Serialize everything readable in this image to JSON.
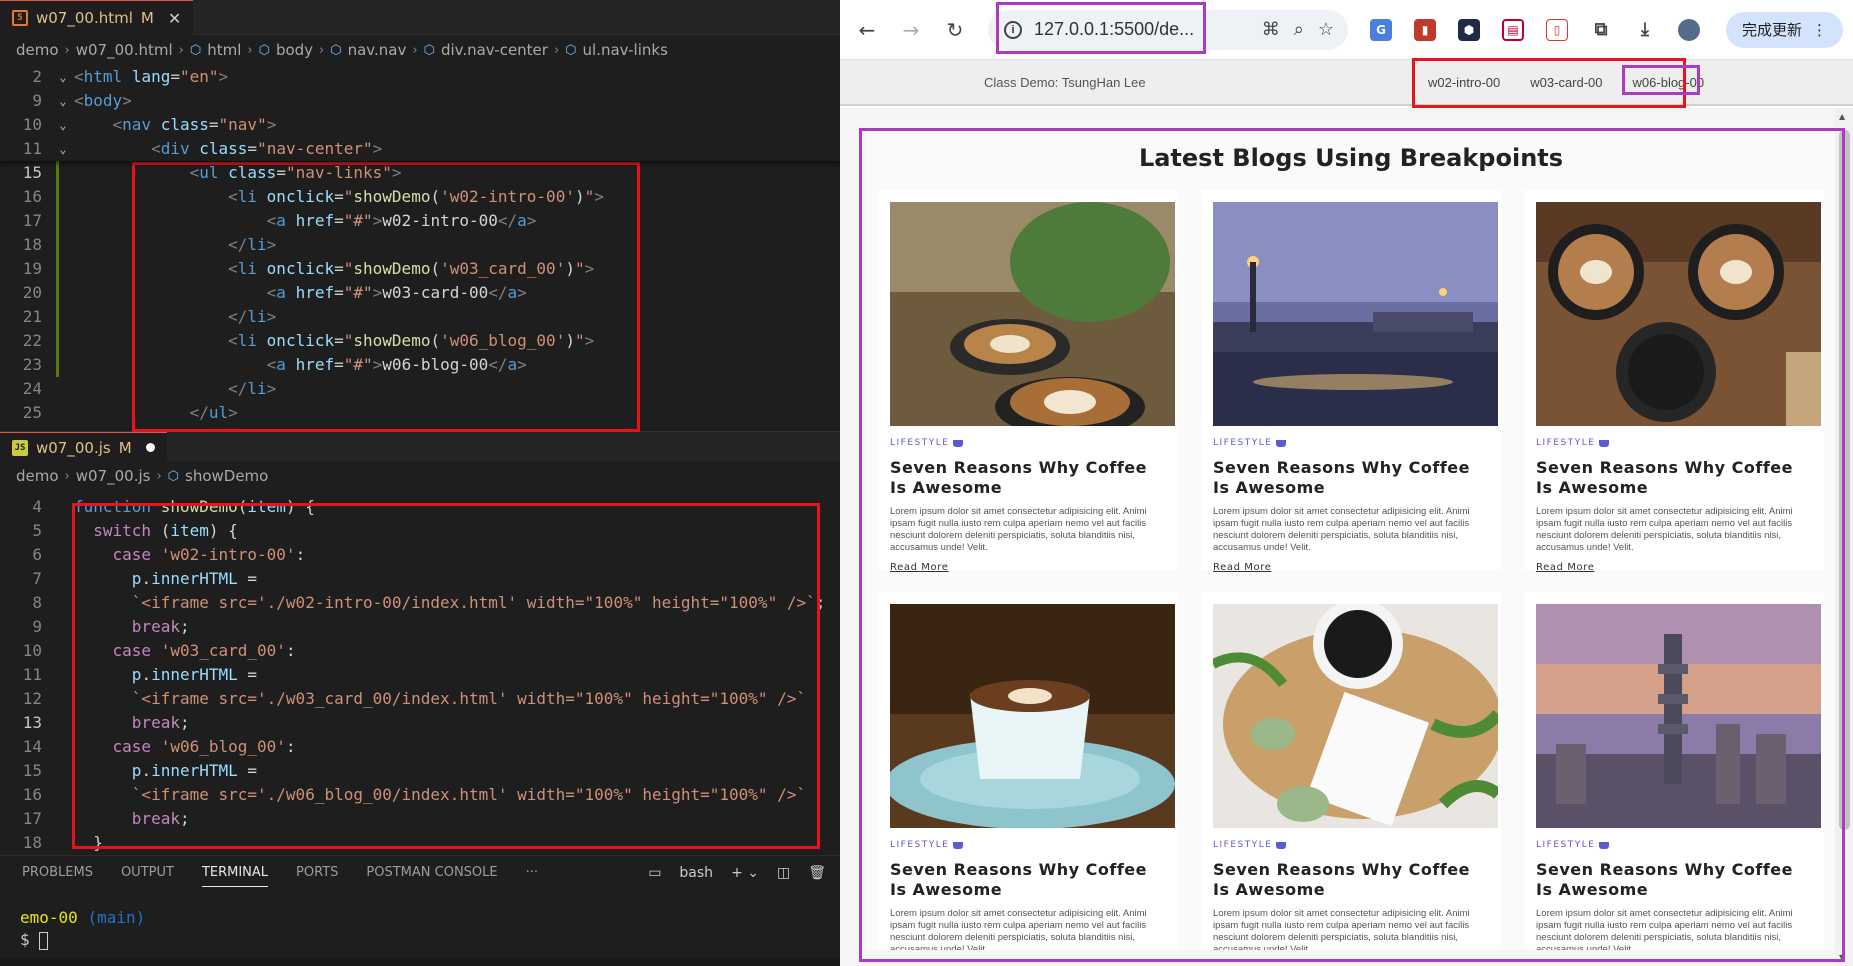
{
  "editor_top": {
    "tab_label": "w07_00.html",
    "tab_status": "M",
    "breadcrumb": [
      "demo",
      "w07_00.html",
      "html",
      "body",
      "nav.nav",
      "div.nav-center",
      "ul.nav-links"
    ],
    "sticky_lines": [
      {
        "n": "2",
        "html": "<span class=\"ang\">&lt;</span><span class=\"tag\">html</span> <span class=\"attr\">lang</span>=<span class=\"str\">\"en\"</span><span class=\"ang\">&gt;</span>"
      },
      {
        "n": "9",
        "html": "<span class=\"ang\">&lt;</span><span class=\"tag\">body</span><span class=\"ang\">&gt;</span>"
      },
      {
        "n": "10",
        "html": "    <span class=\"ang\">&lt;</span><span class=\"tag\">nav</span> <span class=\"attr\">class</span>=<span class=\"str\">\"nav\"</span><span class=\"ang\">&gt;</span>"
      },
      {
        "n": "11",
        "html": "        <span class=\"ang\">&lt;</span><span class=\"tag\">div</span> <span class=\"attr\">class</span>=<span class=\"str\">\"nav-center\"</span><span class=\"ang\">&gt;</span>"
      }
    ],
    "lines": [
      {
        "n": "15",
        "html": "            <span class=\"ang\">&lt;</span><span class=\"tag\">ul</span> <span class=\"attr\">class</span>=<span class=\"str\">\"nav-links\"</span><span class=\"ang\">&gt;</span>"
      },
      {
        "n": "16",
        "html": "                <span class=\"ang\">&lt;</span><span class=\"tag\">li</span> <span class=\"attr\">onclick</span>=<span class=\"str\">\"</span><span class=\"fn\">showDemo</span><span class=\"txt\">(</span><span class=\"str\">'w02-intro-00'</span><span class=\"txt\">)</span><span class=\"str\">\"</span><span class=\"ang\">&gt;</span>"
      },
      {
        "n": "17",
        "html": "                    <span class=\"ang\">&lt;</span><span class=\"tag\">a</span> <span class=\"attr\">href</span>=<span class=\"str\">\"#\"</span><span class=\"ang\">&gt;</span><span class=\"txt\">w02-intro-00</span><span class=\"ang\">&lt;/</span><span class=\"tag\">a</span><span class=\"ang\">&gt;</span>"
      },
      {
        "n": "18",
        "html": "                <span class=\"ang\">&lt;/</span><span class=\"tag\">li</span><span class=\"ang\">&gt;</span>"
      },
      {
        "n": "19",
        "html": "                <span class=\"ang\">&lt;</span><span class=\"tag\">li</span> <span class=\"attr\">onclick</span>=<span class=\"str\">\"</span><span class=\"fn\">showDemo</span><span class=\"txt\">(</span><span class=\"str\">'w03_card_00'</span><span class=\"txt\">)</span><span class=\"str\">\"</span><span class=\"ang\">&gt;</span>"
      },
      {
        "n": "20",
        "html": "                    <span class=\"ang\">&lt;</span><span class=\"tag\">a</span> <span class=\"attr\">href</span>=<span class=\"str\">\"#\"</span><span class=\"ang\">&gt;</span><span class=\"txt\">w03-card-00</span><span class=\"ang\">&lt;/</span><span class=\"tag\">a</span><span class=\"ang\">&gt;</span>"
      },
      {
        "n": "21",
        "html": "                <span class=\"ang\">&lt;/</span><span class=\"tag\">li</span><span class=\"ang\">&gt;</span>"
      },
      {
        "n": "22",
        "html": "                <span class=\"ang\">&lt;</span><span class=\"tag\">li</span> <span class=\"attr\">onclick</span>=<span class=\"str\">\"</span><span class=\"fn\">showDemo</span><span class=\"txt\">(</span><span class=\"str\">'w06_blog_00'</span><span class=\"txt\">)</span><span class=\"str\">\"</span><span class=\"ang\">&gt;</span>"
      },
      {
        "n": "23",
        "html": "                    <span class=\"ang\">&lt;</span><span class=\"tag\">a</span> <span class=\"attr\">href</span>=<span class=\"str\">\"#\"</span><span class=\"ang\">&gt;</span><span class=\"txt\">w06-blog-00</span><span class=\"ang\">&lt;/</span><span class=\"tag\">a</span><span class=\"ang\">&gt;</span>"
      },
      {
        "n": "24",
        "html": "                <span class=\"ang\">&lt;/</span><span class=\"tag\">li</span><span class=\"ang\">&gt;</span>"
      },
      {
        "n": "25",
        "html": "            <span class=\"ang\">&lt;/</span><span class=\"tag\">ul</span><span class=\"ang\">&gt;</span>"
      }
    ]
  },
  "editor_bottom": {
    "tab_label": "w07_00.js",
    "tab_status": "M",
    "breadcrumb": [
      "demo",
      "w07_00.js",
      "showDemo"
    ],
    "lines": [
      {
        "n": "4",
        "html": "<span class=\"kw2\">function</span> <span class=\"fn\">showDemo</span><span class=\"txt\">(</span><span class=\"var\">item</span><span class=\"txt\">) {</span>"
      },
      {
        "n": "5",
        "html": "  <span class=\"kw\">switch</span> <span class=\"txt\">(</span><span class=\"var\">item</span><span class=\"txt\">) {</span>"
      },
      {
        "n": "6",
        "html": "    <span class=\"kw\">case</span> <span class=\"str\">'w02-intro-00'</span><span class=\"txt\">:</span>"
      },
      {
        "n": "7",
        "html": "      <span class=\"var\">p</span><span class=\"txt\">.</span><span class=\"var\">innerHTML</span> <span class=\"txt\">=</span>"
      },
      {
        "n": "8",
        "html": "      <span class=\"str\">`&lt;iframe src='./w02-intro-00/index.html' width=\"100%\" height=\"100%\" /&gt;`</span><span class=\"txt\">;</span>"
      },
      {
        "n": "9",
        "html": "      <span class=\"kw\">break</span><span class=\"txt\">;</span>"
      },
      {
        "n": "10",
        "html": "    <span class=\"kw\">case</span> <span class=\"str\">'w03_card_00'</span><span class=\"txt\">:</span>"
      },
      {
        "n": "11",
        "html": "      <span class=\"var\">p</span><span class=\"txt\">.</span><span class=\"var\">innerHTML</span> <span class=\"txt\">=</span>"
      },
      {
        "n": "12",
        "html": "      <span class=\"str\">`&lt;iframe src='./w03_card_00/index.html' width=\"100%\" height=\"100%\" /&gt;`</span>"
      },
      {
        "n": "13",
        "html": "      <span class=\"kw\">break</span><span class=\"txt\">;</span>"
      },
      {
        "n": "14",
        "html": "    <span class=\"kw\">case</span> <span class=\"str\">'w06_blog_00'</span><span class=\"txt\">:</span>"
      },
      {
        "n": "15",
        "html": "      <span class=\"var\">p</span><span class=\"txt\">.</span><span class=\"var\">innerHTML</span> <span class=\"txt\">=</span>"
      },
      {
        "n": "16",
        "html": "      <span class=\"str\">`&lt;iframe src='./w06_blog_00/index.html' width=\"100%\" height=\"100%\" /&gt;`</span>"
      },
      {
        "n": "17",
        "html": "      <span class=\"kw\">break</span><span class=\"txt\">;</span>"
      },
      {
        "n": "18",
        "html": "  <span class=\"txt\">}</span>"
      }
    ]
  },
  "panel": {
    "tabs": [
      "PROBLEMS",
      "OUTPUT",
      "TERMINAL",
      "PORTS",
      "POSTMAN CONSOLE"
    ],
    "active_tab": "TERMINAL",
    "shell": "bash",
    "term_line1_a": "emo-00",
    "term_line1_b": "(main)",
    "term_prompt": "$"
  },
  "browser": {
    "url": "127.0.0.1:5500/de...",
    "update_label": "完成更新",
    "nav_brand": "Class Demo: TsungHan Lee",
    "nav_links": [
      "w02-intro-00",
      "w03-card-00",
      "w06-blog-00"
    ],
    "blog_title": "Latest Blogs Using Breakpoints",
    "category": "LIFESTYLE",
    "card_title": "Seven Reasons Why Coffee Is Awesome",
    "card_text": "Lorem ipsum dolor sit amet consectetur adipisicing elit. Animi ipsam fugit nulla iusto rem culpa aperiam nemo vel aut facilis nesciunt dolorem deleniti perspiciatis, soluta blanditiis nisi, accusamus unde! Velit.",
    "read_more": "Read More"
  }
}
